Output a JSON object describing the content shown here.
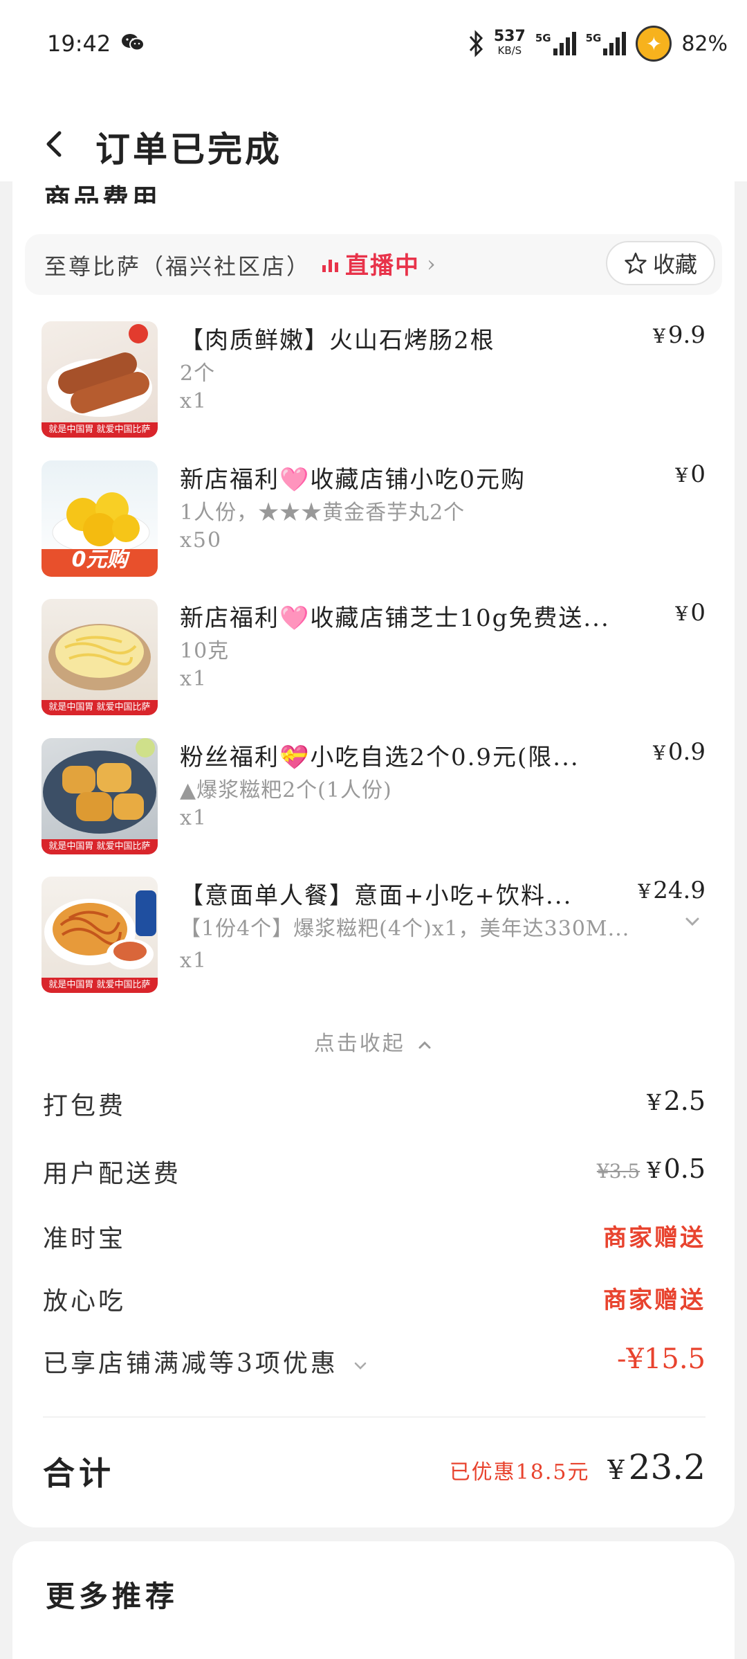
{
  "status_bar": {
    "time": "19:42",
    "net_speed": "537",
    "net_unit": "KB/S",
    "signal1": "5G",
    "signal2": "5G",
    "battery": "82%"
  },
  "nav": {
    "title": "订单已完成"
  },
  "section": {
    "title": "商品费用"
  },
  "shop": {
    "name": "至尊比萨（福兴社区店）",
    "live_label": "直播中",
    "live_color": "#e8334a",
    "fav_label": "收藏"
  },
  "items": [
    {
      "name": "【肉质鲜嫩】火山石烤肠2根",
      "price": "9.9",
      "spec": "2个",
      "qty": "x1",
      "band": "就是中国胃 就爱中国比萨"
    },
    {
      "name": "新店福利🩷收藏店铺小吃0元购",
      "price": "0",
      "spec": "1人份，★★★黄金香芋丸2个",
      "qty": "x50",
      "band": "0元购"
    },
    {
      "name": "新店福利🩷收藏店铺芝士10g免费送...",
      "price": "0",
      "spec": "10克",
      "qty": "x1",
      "band": "就是中国胃 就爱中国比萨"
    },
    {
      "name": "粉丝福利💝小吃自选2个0.9元(限...",
      "price": "0.9",
      "spec": "▲爆浆糍粑2个(1人份)",
      "qty": "x1",
      "band": "就是中国胃 就爱中国比萨"
    },
    {
      "name": "【意面单人餐】意面+小吃+饮料...",
      "price": "24.9",
      "spec": "【1份4个】爆浆糍粑(4个)x1，美年达330M...",
      "qty": "x1",
      "band": "就是中国胃 就爱中国比萨"
    }
  ],
  "currency": "¥",
  "collapse_label": "点击收起",
  "fees": {
    "packing": {
      "label": "打包费",
      "value": "2.5"
    },
    "delivery": {
      "label": "用户配送费",
      "original": "¥3.5",
      "value": "0.5"
    },
    "ontime": {
      "label": "准时宝",
      "value": "商家赠送"
    },
    "safe": {
      "label": "放心吃",
      "value": "商家赠送"
    },
    "discount": {
      "label": "已享店铺满减等3项优惠",
      "value": "-¥15.5"
    }
  },
  "total": {
    "label": "合计",
    "saved": "已优惠18.5元",
    "amount": "23.2"
  },
  "more": {
    "title": "更多推荐"
  },
  "colors": {
    "accent_red": "#e8432e",
    "brand_band": "#d9252b"
  }
}
